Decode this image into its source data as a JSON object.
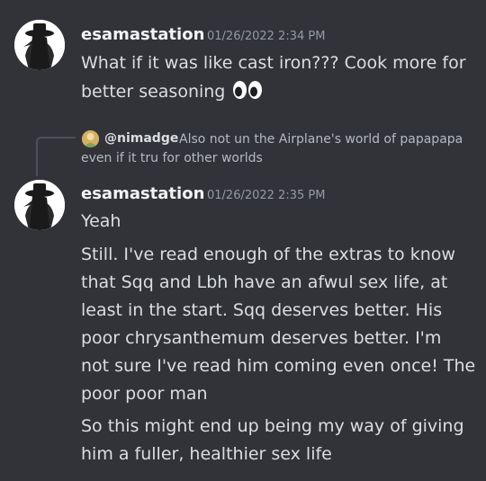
{
  "messages": [
    {
      "author": "esamastation",
      "timestamp": "01/26/2022 2:34 PM",
      "lines": [
        "What if it was like cast iron??? Cook more for",
        "better seasoning"
      ],
      "emoji": "eyes-emoji"
    },
    {
      "reply": {
        "mention": "@nimadge",
        "text_line1": "Also not un the Airplane's world of papapapa",
        "text_line2": "even if it tru for other worlds"
      },
      "author": "esamastation",
      "timestamp": "01/26/2022 2:35 PM",
      "lines": [
        "Yeah",
        "Still. I've read enough of the extras to know",
        "that Sqq and Lbh have an afwul sex life, at",
        "least in the start. Sqq deserves better. His",
        "poor chrysanthemum deserves better. I'm",
        "not sure I've read him coming even once! The",
        "poor poor man",
        "So this might end up being my way of giving",
        "him a fuller, healthier sex life"
      ]
    }
  ],
  "colors": {
    "background": "#313338",
    "text": "#dbdee1",
    "username": "#f2f3f5",
    "timestamp": "#949ba4",
    "reply_text": "#b5bac1"
  }
}
